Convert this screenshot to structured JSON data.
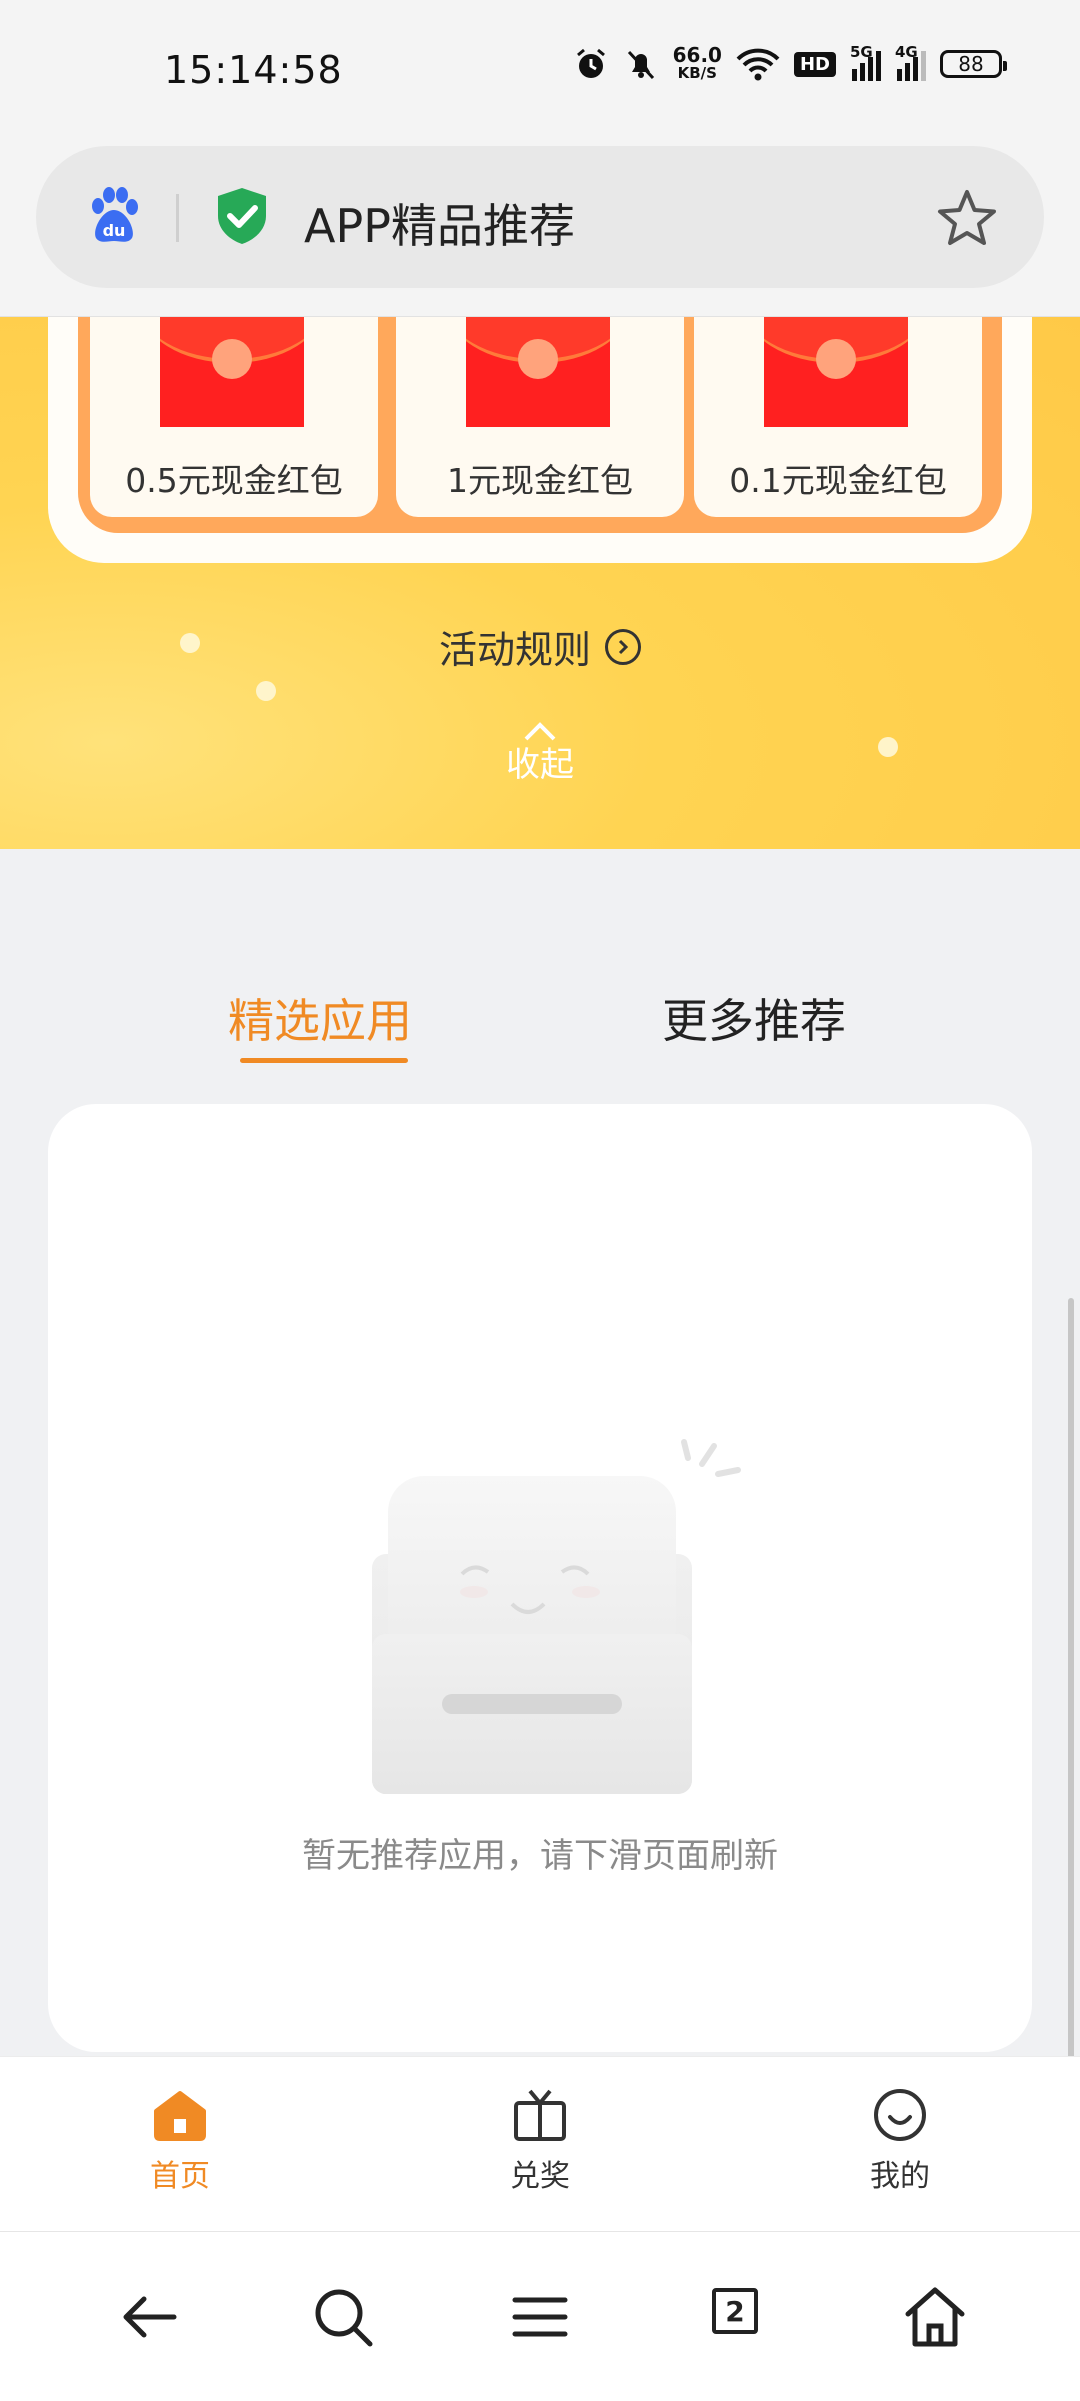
{
  "status_bar": {
    "time": "15:14:58",
    "net_speed_value": "66.0",
    "net_speed_unit": "KB/S",
    "hd_badge": "HD",
    "signal_5g": "5G",
    "signal_4g": "4G",
    "battery": "88"
  },
  "address_bar": {
    "title": "APP精品推荐"
  },
  "rewards": [
    {
      "label": "0.5元现金红包"
    },
    {
      "label": "1元现金红包"
    },
    {
      "label": "0.1元现金红包"
    }
  ],
  "banner": {
    "rules_label": "活动规则",
    "collapse_label": "收起"
  },
  "tabs": {
    "active": "精选应用",
    "more": "更多推荐"
  },
  "empty_state": {
    "message": "暂无推荐应用，请下滑页面刷新"
  },
  "page_tabbar": {
    "home": "首页",
    "redeem": "兑奖",
    "mine": "我的"
  },
  "browser_nav": {
    "tab_count": "2"
  },
  "colors": {
    "accent": "#f08a24",
    "banner_yellow": "#ffd452",
    "envelope_red": "#ff2020"
  }
}
